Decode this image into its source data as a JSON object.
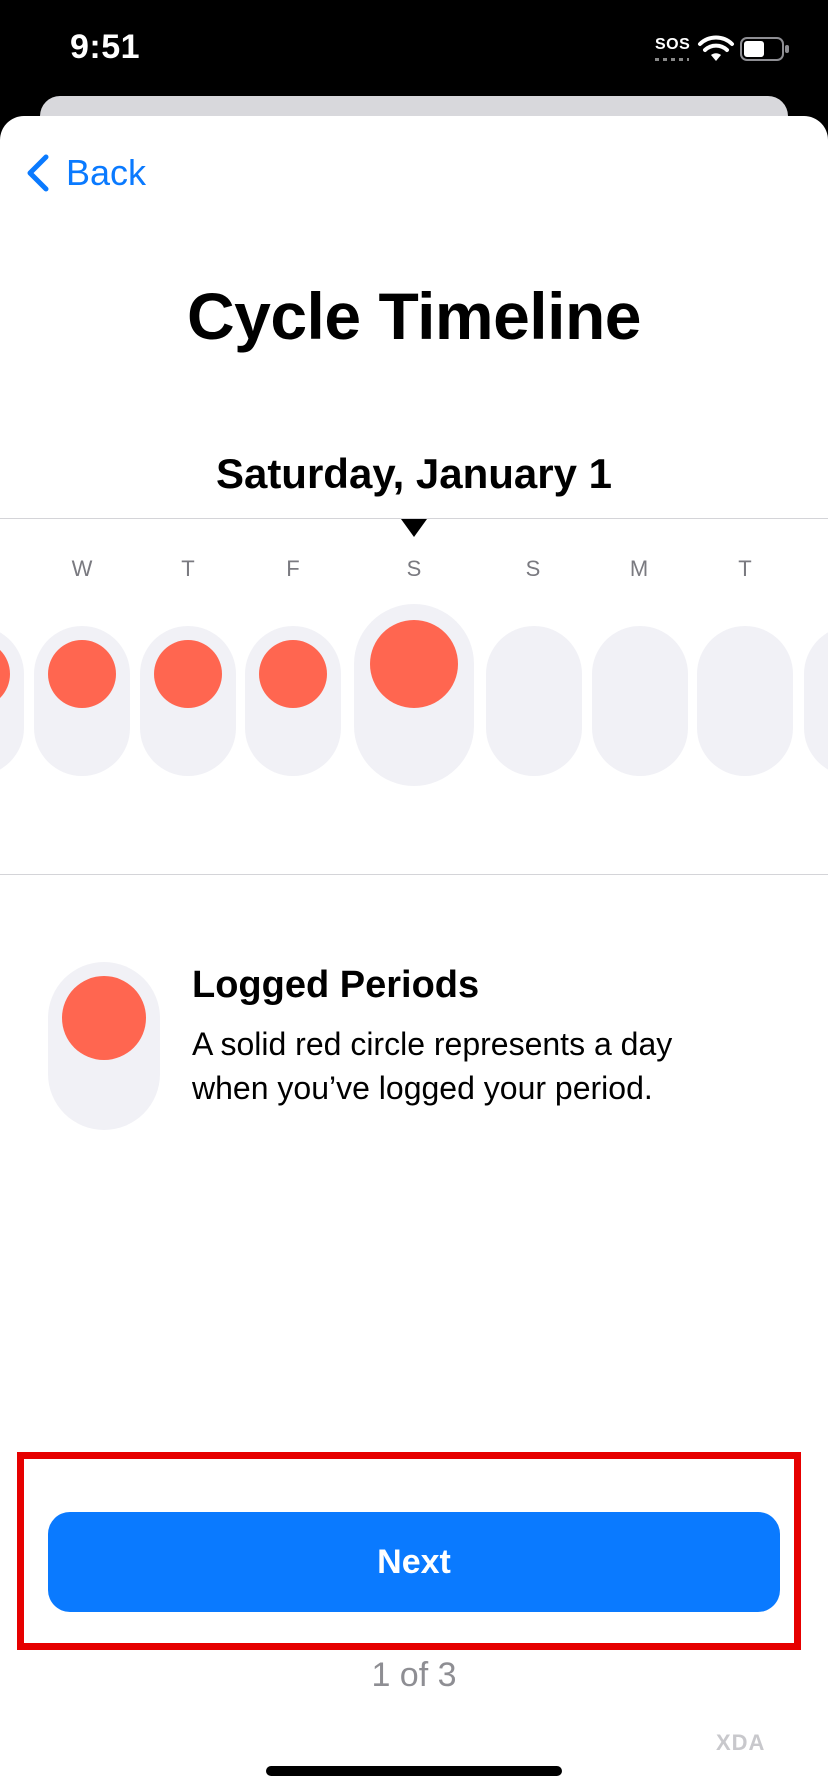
{
  "status_bar": {
    "time": "9:51",
    "sos": "SOS",
    "icons": [
      "wifi-icon",
      "battery-icon"
    ]
  },
  "nav": {
    "back_label": "Back",
    "back_icon": "chevron-left-icon"
  },
  "title": "Cycle Timeline",
  "timeline": {
    "selected_date": "Saturday, January 1",
    "days": [
      {
        "letter": "",
        "logged": true
      },
      {
        "letter": "W",
        "logged": true
      },
      {
        "letter": "T",
        "logged": true
      },
      {
        "letter": "F",
        "logged": true
      },
      {
        "letter": "S",
        "logged": true,
        "selected": true
      },
      {
        "letter": "S",
        "logged": false
      },
      {
        "letter": "M",
        "logged": false
      },
      {
        "letter": "T",
        "logged": false
      },
      {
        "letter": "",
        "logged": false
      }
    ]
  },
  "legend": {
    "title": "Logged Periods",
    "description": "A solid red circle represents a day when you’ve logged your period."
  },
  "footer": {
    "next_label": "Next",
    "page_indicator": "1 of 3"
  },
  "watermark": "XDA",
  "colors": {
    "accent": "#0a7aff",
    "period_red": "#ff6650",
    "pill_bg": "#f1f1f6",
    "highlight": "#e60000"
  }
}
